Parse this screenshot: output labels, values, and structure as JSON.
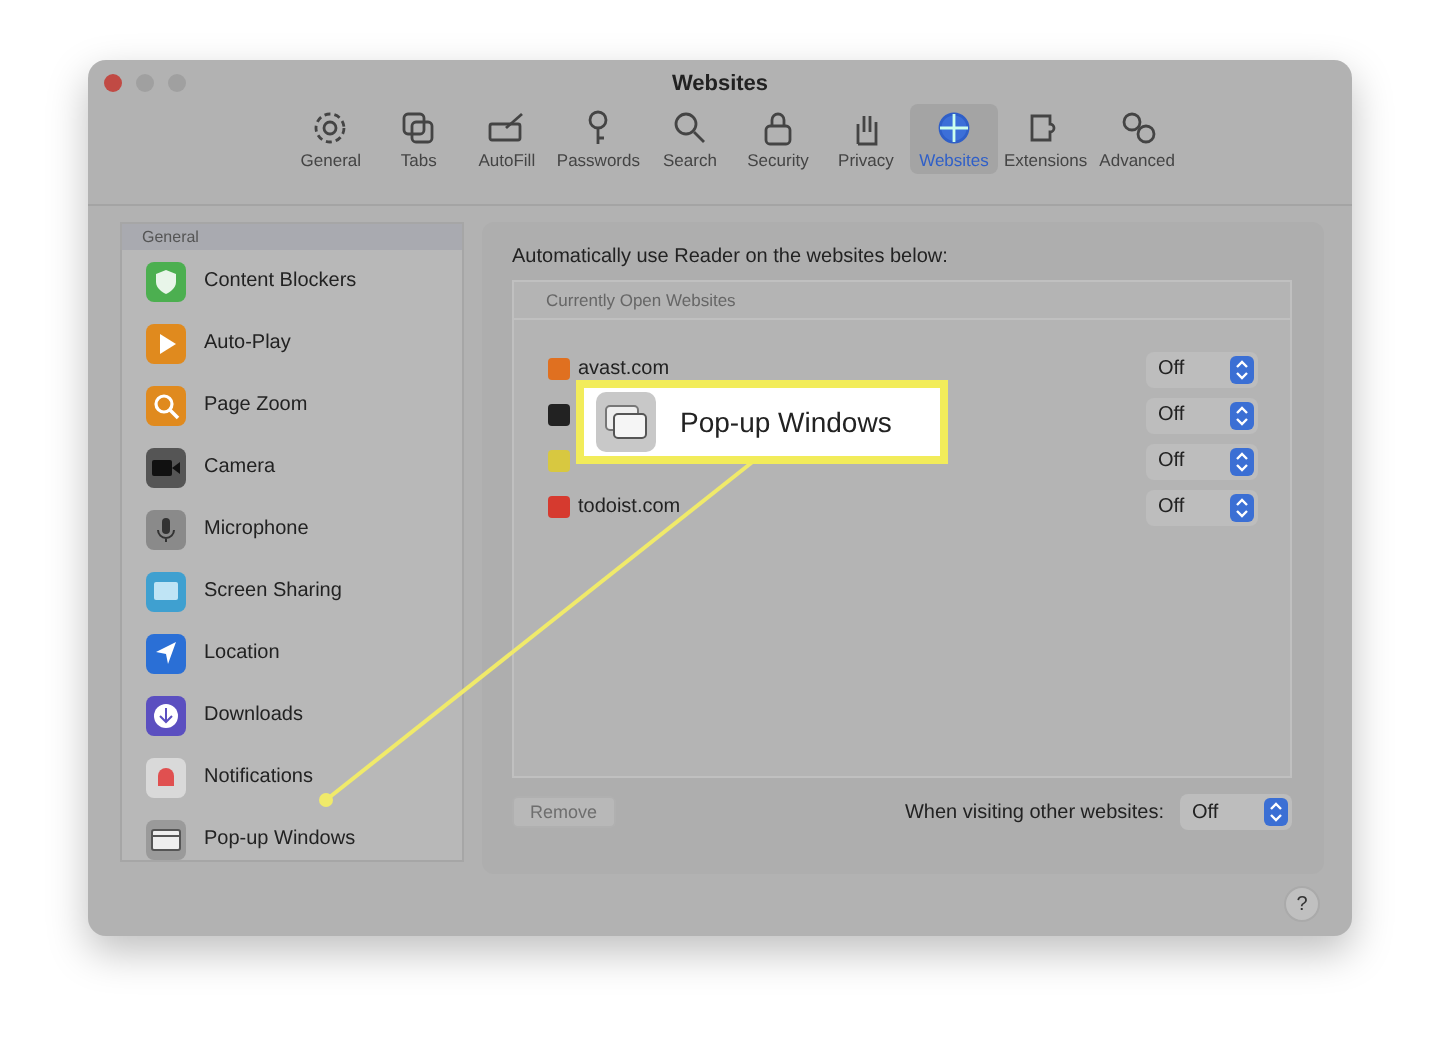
{
  "window": {
    "title": "Websites"
  },
  "toolbar": [
    {
      "label": "General",
      "selected": false
    },
    {
      "label": "Tabs",
      "selected": false
    },
    {
      "label": "AutoFill",
      "selected": false
    },
    {
      "label": "Passwords",
      "selected": false
    },
    {
      "label": "Search",
      "selected": false
    },
    {
      "label": "Security",
      "selected": false
    },
    {
      "label": "Privacy",
      "selected": false
    },
    {
      "label": "Websites",
      "selected": true
    },
    {
      "label": "Extensions",
      "selected": false
    },
    {
      "label": "Advanced",
      "selected": false
    }
  ],
  "sidebar": {
    "header": "General",
    "items": [
      {
        "label": "Content Blockers",
        "color": "#4caf50"
      },
      {
        "label": "Auto-Play",
        "color": "#e08a1e"
      },
      {
        "label": "Page Zoom",
        "color": "#e08a1e"
      },
      {
        "label": "Camera",
        "color": "#555555"
      },
      {
        "label": "Microphone",
        "color": "#8a8a8a"
      },
      {
        "label": "Screen Sharing",
        "color": "#3fa0d0"
      },
      {
        "label": "Location",
        "color": "#2a6fd6"
      },
      {
        "label": "Downloads",
        "color": "#5b4fc0"
      },
      {
        "label": "Notifications",
        "color": "#d9d9d9"
      },
      {
        "label": "Pop-up Windows",
        "color": "#9a9a9a"
      }
    ]
  },
  "panel": {
    "description": "Automatically use Reader on the websites below:",
    "table_header": "Currently Open Websites",
    "sites": [
      {
        "name": "avast.com",
        "value": "Off",
        "color": "#e07020"
      },
      {
        "value": "Off",
        "color": "#222222"
      },
      {
        "value": "Off",
        "color": "#d8c840"
      },
      {
        "name": "todoist.com",
        "value": "Off",
        "color": "#d63a2f"
      }
    ],
    "remove_button": {
      "label": "Remove",
      "disabled": true
    },
    "other_label": "When visiting other websites:",
    "other_value": "Off"
  },
  "help": "?",
  "callout": {
    "label": "Pop-up Windows"
  }
}
